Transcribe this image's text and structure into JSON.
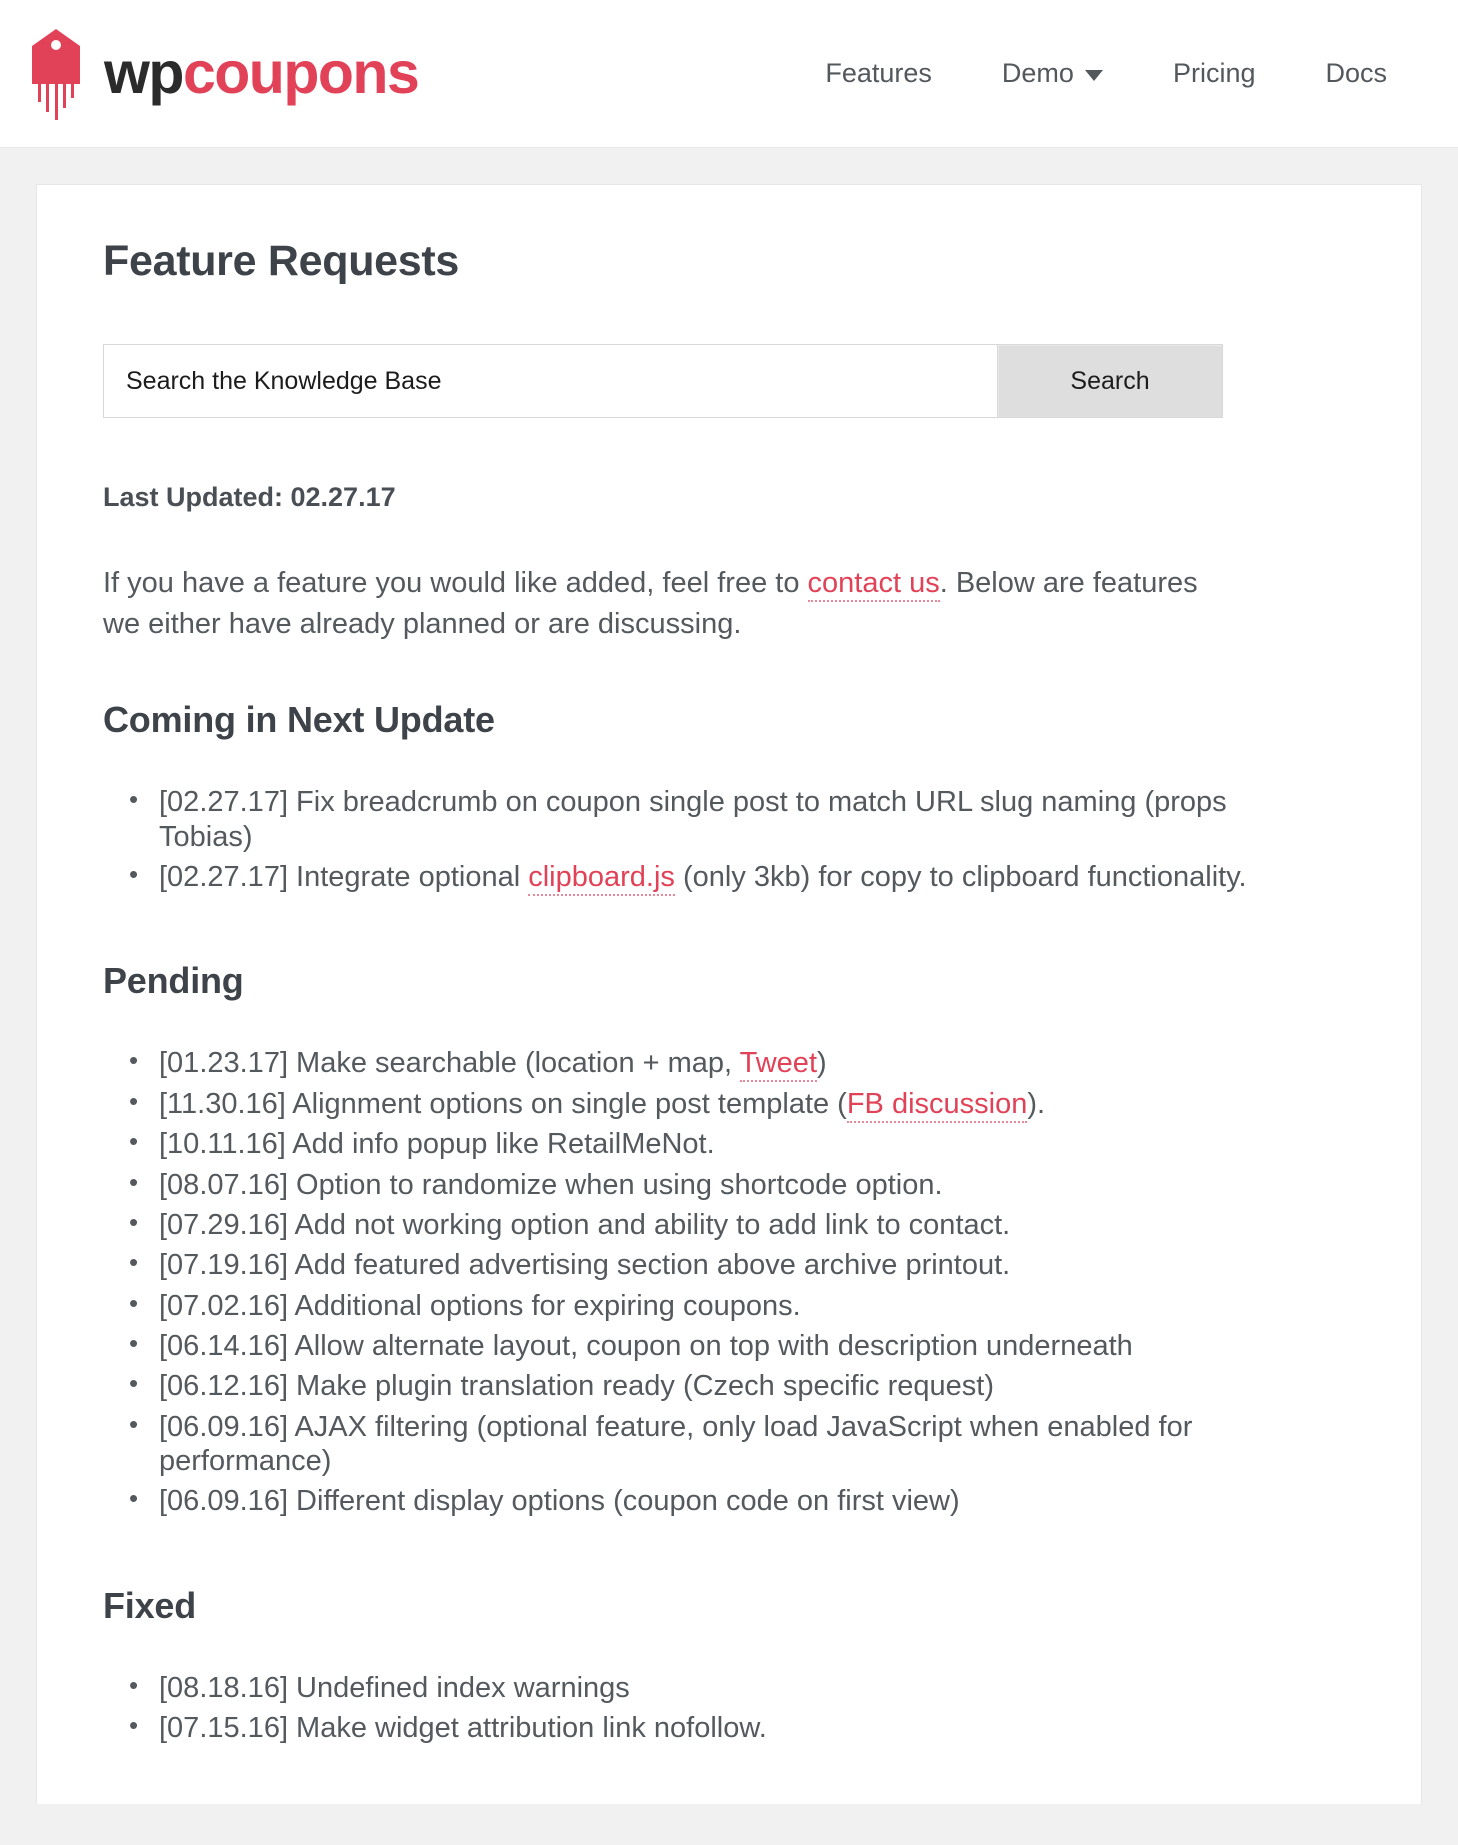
{
  "header": {
    "brand": {
      "wp": "wp",
      "coupons": "coupons",
      "logo_icon": "coupon-tag-icon"
    },
    "nav": [
      {
        "label": "Features",
        "has_caret": false
      },
      {
        "label": "Demo",
        "has_caret": true,
        "caret_icon": "chevron-down-icon"
      },
      {
        "label": "Pricing",
        "has_caret": false
      },
      {
        "label": "Docs",
        "has_caret": false
      }
    ]
  },
  "page": {
    "title": "Feature Requests",
    "last_updated": "Last Updated: 02.27.17",
    "intro": {
      "before_link": "If you have a feature you would like added, feel free to ",
      "link_text": "contact us",
      "after_link": ". Below are features we either have already planned or are discussing."
    }
  },
  "search": {
    "placeholder": "Search the Knowledge Base",
    "value": "",
    "button_label": "Search"
  },
  "sections": [
    {
      "id": "coming-in-next-update",
      "title": "Coming in Next Update",
      "items": [
        {
          "text": "[02.27.17] Fix breadcrumb on coupon single post to match URL slug naming (props Tobias)"
        },
        {
          "before_link": "[02.27.17] Integrate optional ",
          "link_text": "clipboard.js",
          "after_link": " (only 3kb) for copy to clipboard functionality."
        }
      ]
    },
    {
      "id": "pending",
      "title": "Pending",
      "items": [
        {
          "before_link": "[01.23.17] Make searchable (location + map, ",
          "link_text": "Tweet",
          "after_link": ")"
        },
        {
          "before_link": "[11.30.16] Alignment options on single post template (",
          "link_text": "FB discussion",
          "after_link": ")."
        },
        {
          "text": "[10.11.16] Add info popup like RetailMeNot."
        },
        {
          "text": "[08.07.16] Option to randomize when using shortcode option."
        },
        {
          "text": "[07.29.16] Add not working option and ability to add link to contact."
        },
        {
          "text": "[07.19.16] Add featured advertising section above archive printout."
        },
        {
          "text": "[07.02.16] Additional options for expiring coupons."
        },
        {
          "text": "[06.14.16] Allow alternate layout, coupon on top with description underneath"
        },
        {
          "text": "[06.12.16] Make plugin translation ready (Czech specific request)"
        },
        {
          "text": "[06.09.16] AJAX filtering (optional feature, only load JavaScript when enabled for performance)"
        },
        {
          "text": "[06.09.16] Different display options (coupon code on first view)"
        }
      ]
    },
    {
      "id": "fixed",
      "title": "Fixed",
      "items": [
        {
          "text": "[08.18.16] Undefined index warnings"
        },
        {
          "text": "[07.15.16] Make widget attribution link nofollow."
        }
      ]
    }
  ],
  "colors": {
    "brand_red": "#e14257",
    "text_gray": "#54595e",
    "heading_gray": "#3d4349",
    "nav_gray": "#53585d",
    "button_gray": "#dedede"
  }
}
